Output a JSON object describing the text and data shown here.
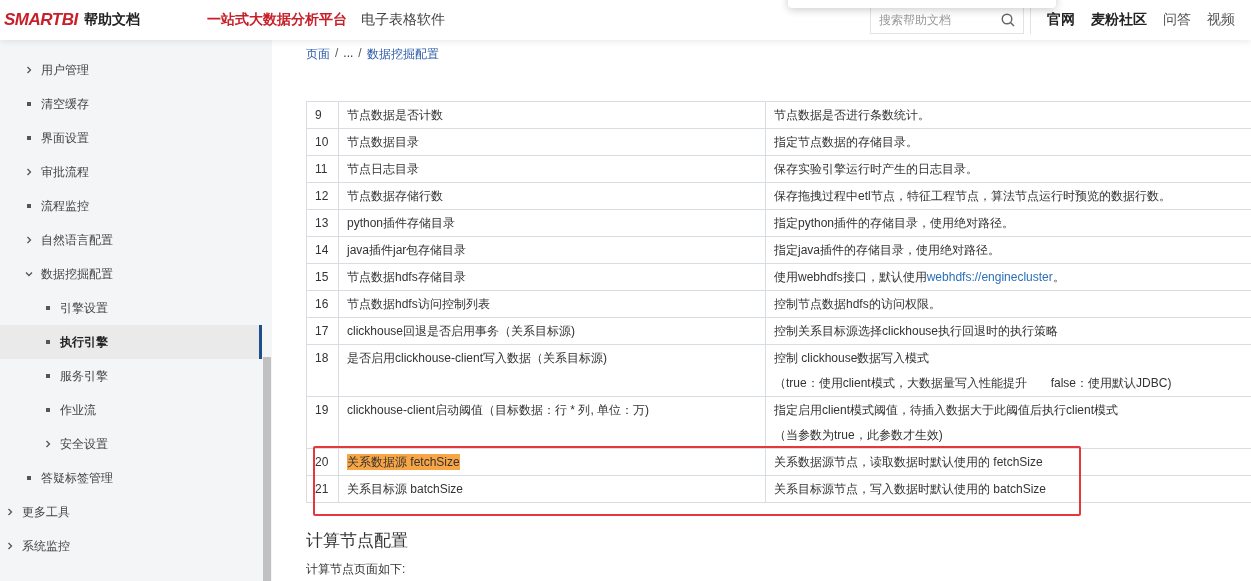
{
  "header": {
    "logo": "SMARTBI",
    "logo_subtitle": "帮助文档",
    "nav": [
      {
        "label": "一站式大数据分析平台",
        "selected": true
      },
      {
        "label": "电子表格软件",
        "selected": false
      }
    ],
    "search": {
      "placeholder": "搜索帮助文档"
    },
    "links": [
      {
        "label": "官网",
        "bold": true
      },
      {
        "label": "麦粉社区",
        "bold": true
      },
      {
        "label": "问答",
        "bold": false
      },
      {
        "label": "视频",
        "bold": false
      }
    ]
  },
  "sidebar": {
    "items": [
      {
        "children": [
          {
            "label": "用户管理",
            "kind": "folder",
            "expanded": false,
            "selected": false
          },
          {
            "label": "清空缓存",
            "kind": "page",
            "selected": false
          },
          {
            "label": "界面设置",
            "kind": "page",
            "selected": false
          },
          {
            "label": "审批流程",
            "kind": "folder",
            "expanded": false,
            "selected": false
          },
          {
            "label": "流程监控",
            "kind": "page",
            "selected": false
          },
          {
            "label": "自然语言配置",
            "kind": "folder",
            "expanded": false,
            "selected": false
          },
          {
            "label": "数据挖掘配置",
            "kind": "folder",
            "expanded": true,
            "selected": false,
            "children": [
              {
                "label": "引擎设置",
                "kind": "page",
                "selected": false
              },
              {
                "label": "执行引擎",
                "kind": "page",
                "selected": true
              },
              {
                "label": "服务引擎",
                "kind": "page",
                "selected": false
              },
              {
                "label": "作业流",
                "kind": "page",
                "selected": false
              },
              {
                "label": "安全设置",
                "kind": "folder",
                "expanded": false,
                "selected": false
              }
            ]
          },
          {
            "label": "答疑标签管理",
            "kind": "page",
            "selected": false
          }
        ]
      },
      {
        "label": "更多工具",
        "kind": "folder",
        "expanded": false,
        "selected": false
      },
      {
        "label": "系统监控",
        "kind": "folder",
        "expanded": false,
        "selected": false
      }
    ]
  },
  "breadcrumb": {
    "items": [
      "页面",
      "...",
      "数据挖掘配置"
    ],
    "separator": "/"
  },
  "table": {
    "rows": [
      {
        "no": "9",
        "name": "节点数据是否计数",
        "description": [
          "节点数据是否进行条数统计。"
        ],
        "highlighted": false,
        "boxed": false
      },
      {
        "no": "10",
        "name": "节点数据目录",
        "description": [
          "指定节点数据的存储目录。"
        ],
        "highlighted": false,
        "boxed": false
      },
      {
        "no": "11",
        "name": "节点日志目录",
        "description": [
          "保存实验引擎运行时产生的日志目录。"
        ],
        "highlighted": false,
        "boxed": false
      },
      {
        "no": "12",
        "name": "节点数据存储行数",
        "description": [
          "保存拖拽过程中etl节点，特征工程节点，算法节点运行时预览的数据行数。"
        ],
        "highlighted": false,
        "boxed": false
      },
      {
        "no": "13",
        "name": "python插件存储目录",
        "description": [
          "指定python插件的存储目录，使用绝对路径。"
        ],
        "highlighted": false,
        "boxed": false
      },
      {
        "no": "14",
        "name": "java插件jar包存储目录",
        "description": [
          "指定java插件的存储目录，使用绝对路径。"
        ],
        "highlighted": false,
        "boxed": false
      },
      {
        "no": "15",
        "name": "节点数据hdfs存储目录",
        "description": [
          "使用webhdfs接口，默认使用"
        ],
        "link": "webhdfs://enginecluster",
        "link_suffix": "。",
        "highlighted": false,
        "boxed": false
      },
      {
        "no": "16",
        "name": "节点数据hdfs访问控制列表",
        "description": [
          "控制节点数据hdfs的访问权限。"
        ],
        "highlighted": false,
        "boxed": false
      },
      {
        "no": "17",
        "name": "clickhouse回退是否启用事务（关系目标源)",
        "description": [
          "控制关系目标源选择clickhouse执行回退时的执行策略"
        ],
        "highlighted": false,
        "boxed": false
      },
      {
        "no": "18",
        "name": "是否启用clickhouse-client写入数据（关系目标源)",
        "description": [
          "控制 clickhouse数据写入模式",
          "（true：使用client模式，大数据量写入性能提升　　false：使用默认JDBC)"
        ],
        "highlighted": false,
        "boxed": false
      },
      {
        "no": "19",
        "name": "clickhouse-client启动阈值（目标数据：行 * 列, 单位：万)",
        "description": [
          "指定启用client模式阈值，待插入数据大于此阈值后执行client模式",
          "（当参数为true，此参数才生效)"
        ],
        "highlighted": false,
        "boxed": false
      },
      {
        "no": "20",
        "name": "关系数据源 fetchSize",
        "description": [
          "关系数据源节点，读取数据时默认使用的 fetchSize"
        ],
        "highlighted": true,
        "boxed": true
      },
      {
        "no": "21",
        "name": "关系目标源 batchSize",
        "description": [
          "关系目标源节点，写入数据时默认使用的 batchSize"
        ],
        "highlighted": false,
        "boxed": true
      }
    ]
  },
  "section": {
    "heading": "计算节点配置",
    "text": "计算节点页面如下:"
  }
}
